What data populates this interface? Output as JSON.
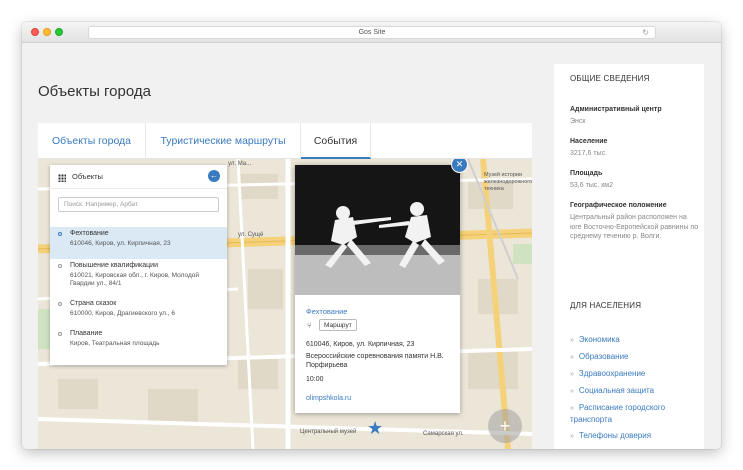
{
  "browser": {
    "url": "Gos Site"
  },
  "page": {
    "title": "Объекты города"
  },
  "tabs": [
    {
      "label": "Объекты города"
    },
    {
      "label": "Туристические маршруты"
    },
    {
      "label": "События"
    }
  ],
  "objects_panel": {
    "title": "Объекты",
    "search_placeholder": "Поиск. Например, Арбат",
    "items": [
      {
        "name": "Фехтование",
        "address": "610046, Киров, ул. Кирпичная, 23"
      },
      {
        "name": "Повышение квалификации",
        "address": "610021, Кировская обл., г. Киров, Молодой Гвардии ул., 84/1"
      },
      {
        "name": "Страна сказок",
        "address": "610000, Киров, Драгиевского ул., 6"
      },
      {
        "name": "Плавание",
        "address": "Киров, Театральная площадь"
      }
    ]
  },
  "popup": {
    "title": "Фехтование",
    "route_label": "Маршрут",
    "address": "610046, Киров, ул. Кирпичная, 23",
    "description": "Всероссийские соревнования памяти Н.В. Порфирьева",
    "time": "10:00",
    "link": "olimpshkola.ru"
  },
  "map_labels": {
    "street_suschevo": "ул. Сущё",
    "street_top": "ул. Ма...",
    "museum": "Музей истории железнодорожного техника",
    "central_museum": "Центральный музей",
    "samarskaya": "Самарская ул."
  },
  "general_info": {
    "heading": "ОБЩИЕ СВЕДЕНИЯ",
    "fields": [
      {
        "label": "Административный центр",
        "value": "Энск"
      },
      {
        "label": "Население",
        "value": "3217,6 тыс."
      },
      {
        "label": "Площадь",
        "value": "53,6 тыс. км2"
      },
      {
        "label": "Географическое положение",
        "value": "Центральный район расположен на юге Восточно-Европейской равнины по среднему течению р. Волги."
      }
    ]
  },
  "population": {
    "heading": "ДЛЯ НАСЕЛЕНИЯ",
    "links": [
      {
        "label": "Экономика"
      },
      {
        "label": "Образование"
      },
      {
        "label": "Здравоохранение"
      },
      {
        "label": "Социальная защита"
      },
      {
        "label": "Расписание городского транспорта"
      },
      {
        "label": "Телефоны доверия"
      }
    ]
  },
  "colors": {
    "accent": "#3a7bbf",
    "map_bg": "#ece6d8",
    "road": "#f5d27a"
  },
  "icons": {
    "back": "arrow-left-icon",
    "close": "close-icon",
    "route": "route-icon",
    "marker": "star-marker-icon",
    "zoom": "zoom-plus-icon",
    "grid": "grid-icon"
  }
}
